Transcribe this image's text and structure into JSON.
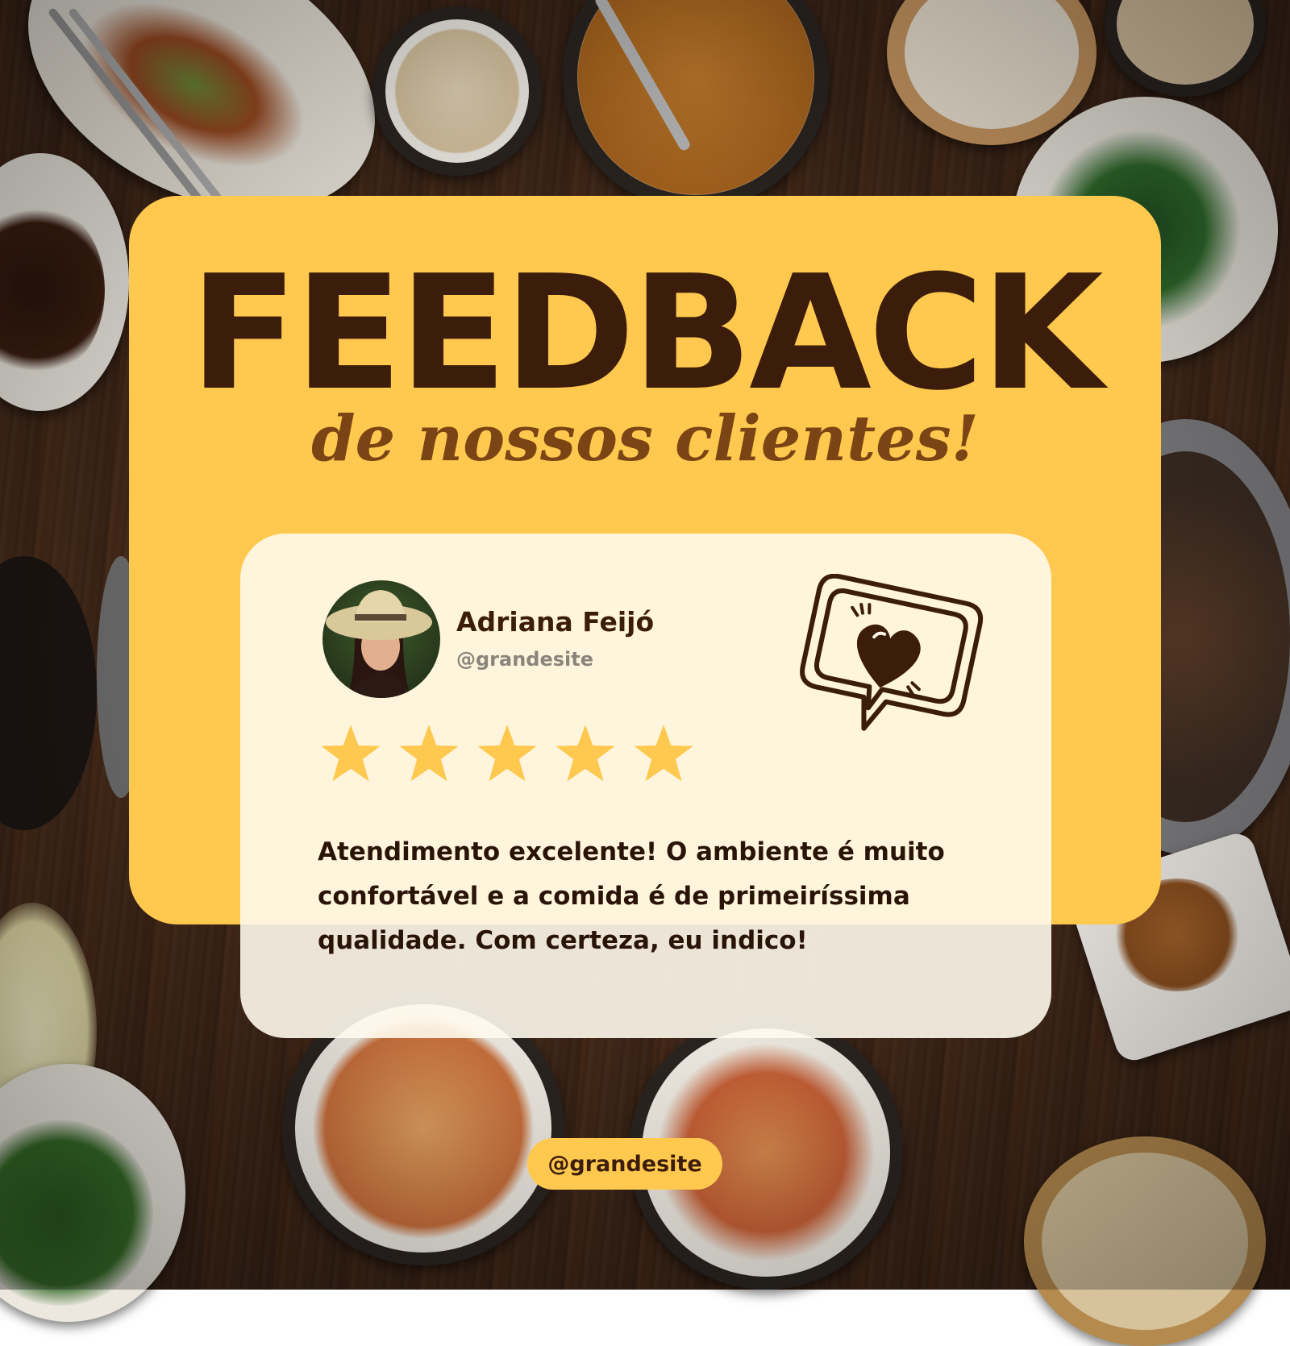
{
  "header": {
    "title": "FEEDBACK",
    "subtitle": "de nossos clientes!"
  },
  "review": {
    "author_name": "Adriana Feijó",
    "author_handle": "@grandesite",
    "rating": 5,
    "rating_max": 5,
    "text": "Atendimento excelente! O ambiente é muito confortável e a comida é de primeiríssima qualidade. Com certeza, eu indico!"
  },
  "footer": {
    "handle": "@grandesite"
  },
  "icons": [
    "star-icon",
    "heart-speech-bubble-icon"
  ],
  "colors": {
    "accent_yellow": "#ffc84e",
    "dark_brown": "#3c1c0a",
    "subtitle_brown": "#7a4414",
    "card_cream": "#fffaec",
    "handle_gray": "#8a857c"
  }
}
